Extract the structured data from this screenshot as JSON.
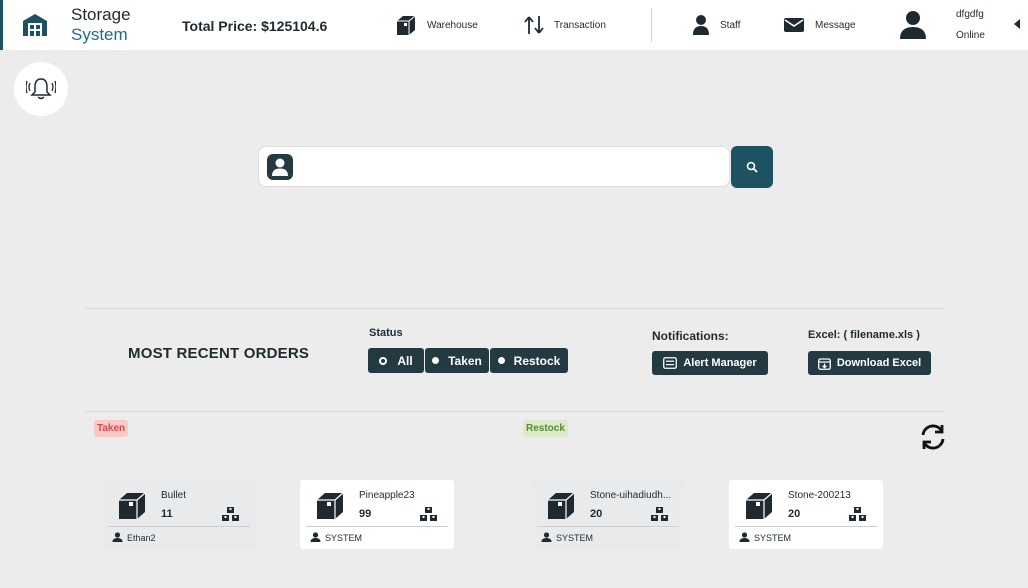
{
  "brand": {
    "line1": "Storage",
    "line2": "System"
  },
  "header": {
    "total_price": "Total Price: $125104.6",
    "nav": {
      "warehouse": "Warehouse",
      "transaction": "Transaction",
      "staff": "Staff",
      "message": "Message"
    },
    "user": {
      "name": "dfgdfg",
      "status": "Online"
    }
  },
  "search": {
    "placeholder": "",
    "value": ""
  },
  "orders": {
    "title": "MOST RECENT ORDERS",
    "status_label": "Status",
    "filters": {
      "all": "All",
      "taken": "Taken",
      "restock": "Restock"
    },
    "notifications_label": "Notifications:",
    "alert_manager": "Alert Manager",
    "excel_label": "Excel:    ( filename.xls )",
    "download_excel": "Download Excel"
  },
  "badges": {
    "taken": "Taken",
    "restock": "Restock"
  },
  "cards": [
    {
      "name": "Bullet",
      "qty": "11",
      "owner": "Ethan2"
    },
    {
      "name": "Pineapple23",
      "qty": "99",
      "owner": "SYSTEM"
    },
    {
      "name": "Stone-uihadiudh...",
      "qty": "20",
      "owner": "SYSTEM"
    },
    {
      "name": "Stone-200213",
      "qty": "20",
      "owner": "SYSTEM"
    }
  ],
  "colors": {
    "accent": "#1d5263",
    "dark_button": "#233a42",
    "taken_badge": "#f9c9c9",
    "restock_badge": "#dbebc8"
  }
}
